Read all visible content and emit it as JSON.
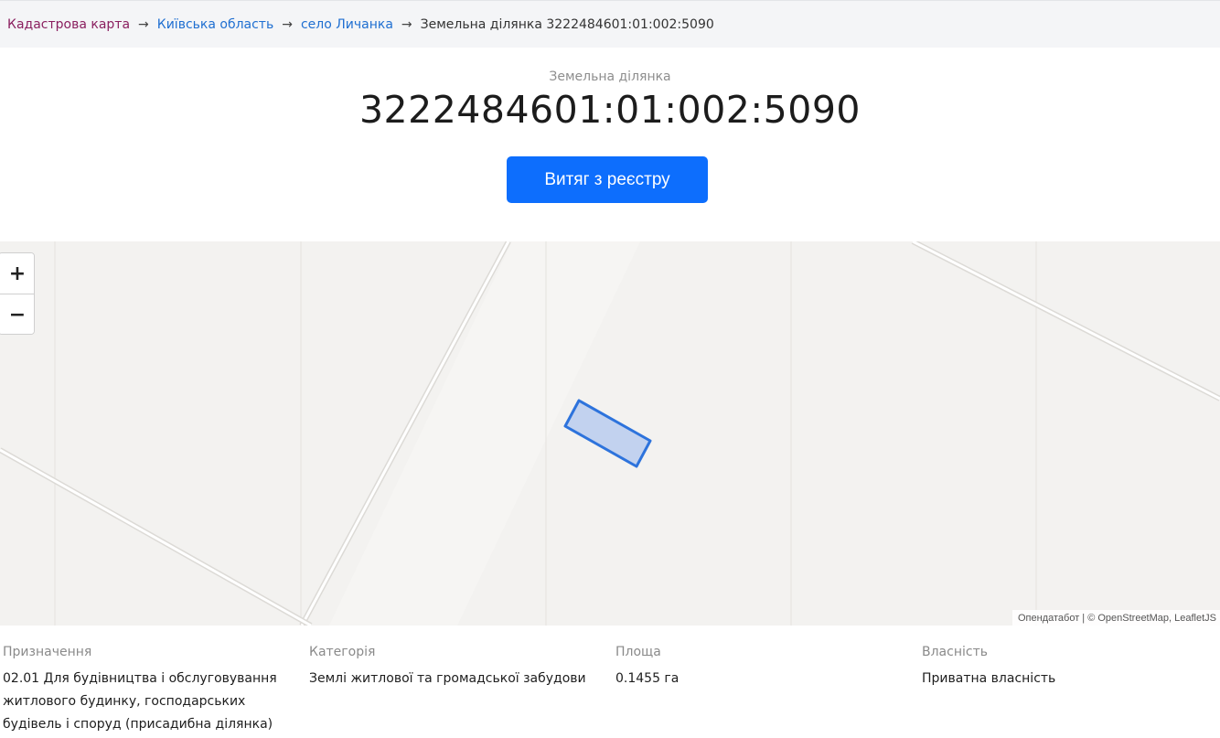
{
  "breadcrumb": {
    "root": "Кадастрова карта",
    "region": "Київська область",
    "village": "село Личанка",
    "current": "Земельна ділянка 3222484601:01:002:5090",
    "separator": "→"
  },
  "header": {
    "subtitle": "Земельна ділянка",
    "cadastral_number": "3222484601:01:002:5090",
    "extract_button": "Витяг з реєстру"
  },
  "map": {
    "zoom_in": "+",
    "zoom_out": "−",
    "attribution": "Опендатабот | © OpenStreetMap, LeafletJS",
    "colors": {
      "background": "#f3f2f0",
      "parcel_fill": "#b8ccee",
      "parcel_stroke": "#2d73dc",
      "road": "#ffffff",
      "road_edge": "#dcdad6",
      "grid": "#e4e2de"
    }
  },
  "details": {
    "purpose": {
      "label": "Призначення",
      "value": "02.01 Для будівництва і обслуговування житлового будинку, господарських будівель і споруд (присадибна ділянка)"
    },
    "category": {
      "label": "Категорія",
      "value": "Землі житлової та громадської забудови"
    },
    "area": {
      "label": "Площа",
      "value": "0.1455 га"
    },
    "ownership": {
      "label": "Власність",
      "value": "Приватна власність"
    }
  },
  "colors": {
    "accent": "#0d6efd",
    "link": "#1f6fd1",
    "root_link": "#8a1f5f"
  }
}
